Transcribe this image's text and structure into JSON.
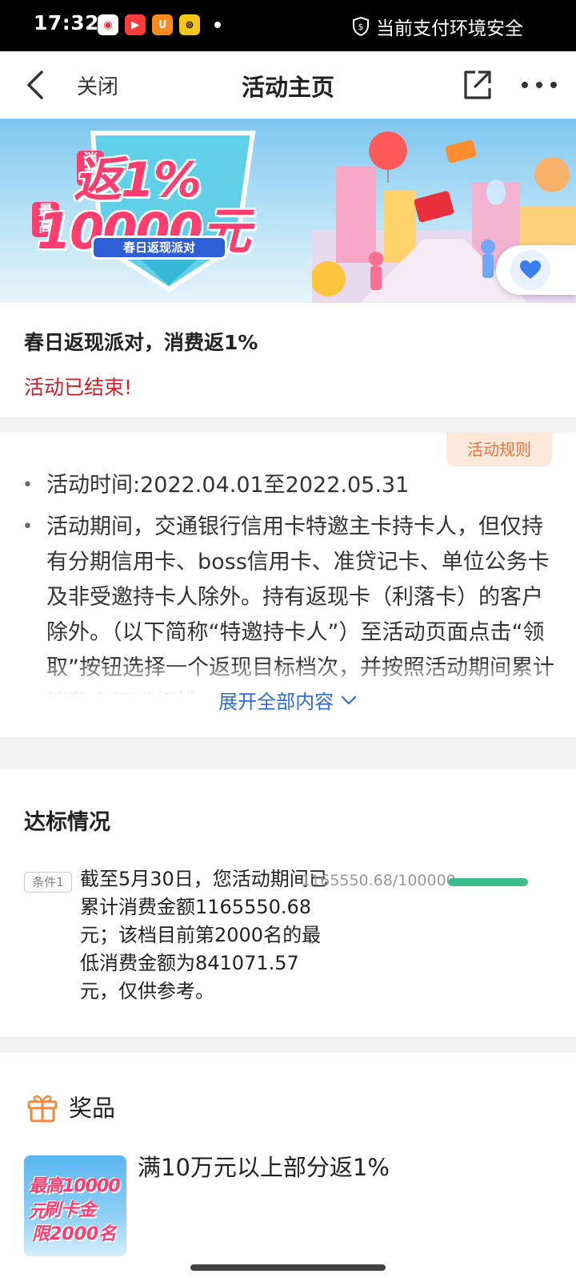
{
  "status_bar": {
    "time": "17:32",
    "apps": [
      {
        "icon": "app-icon-red-white",
        "color": "#ffffff",
        "glyph": "◉"
      },
      {
        "icon": "app-icon-video",
        "color": "#ff3b3b",
        "glyph": "▶"
      },
      {
        "icon": "app-icon-uc-browser",
        "color": "#ff8a1e",
        "glyph": "U"
      },
      {
        "icon": "app-icon-yellow-car",
        "color": "#f5c518",
        "glyph": "⊜"
      }
    ],
    "security_text": "当前支付环境安全"
  },
  "nav": {
    "close_label": "关闭",
    "title": "活动主页"
  },
  "activity": {
    "title": "春日返现派对，消费返1%",
    "status": "活动已结束!"
  },
  "banner": {
    "line1": "返1%",
    "tag1": "消费",
    "line2": "10000元",
    "tag2": "最高",
    "subtitle": "春日返现派对"
  },
  "rules": {
    "button_label": "活动规则",
    "items": [
      "活动时间:2022.04.01至2022.05.31",
      "活动期间，交通银行信用卡特邀主卡持卡人，但仅持有分期信用卡、boss信用卡、准贷记卡、单位公务卡及非受邀持卡人除外。持有返现卡（利落卡）的客户除外。（以下简称“特邀持卡人”）至活动页面点击“领取”按钮选择一个返现目标档次，并按照活动期间累计消费金额进行排"
    ],
    "expand_label": "展开全部内容"
  },
  "standard": {
    "title": "达标情况",
    "condition_tag": "条件1",
    "condition_text": "截至5月30日，您活动期间已累计消费金额1165550.68元；该档目前第2000名的最低消费金额为841071.57元，仅供参考。",
    "progress_text": "1165550.68/100000",
    "progress_fraction": 1.0
  },
  "prize": {
    "label": "奖品",
    "image_line1": "最高10000元",
    "image_line2": "刷卡金",
    "image_line3": "限2000名",
    "description": "满10万元以上部分返1%"
  },
  "colors": {
    "accent_red": "#d0202a",
    "link_blue": "#2a6ed8",
    "rules_orange": "#e4753a",
    "progress_green": "#3bbc8c"
  }
}
